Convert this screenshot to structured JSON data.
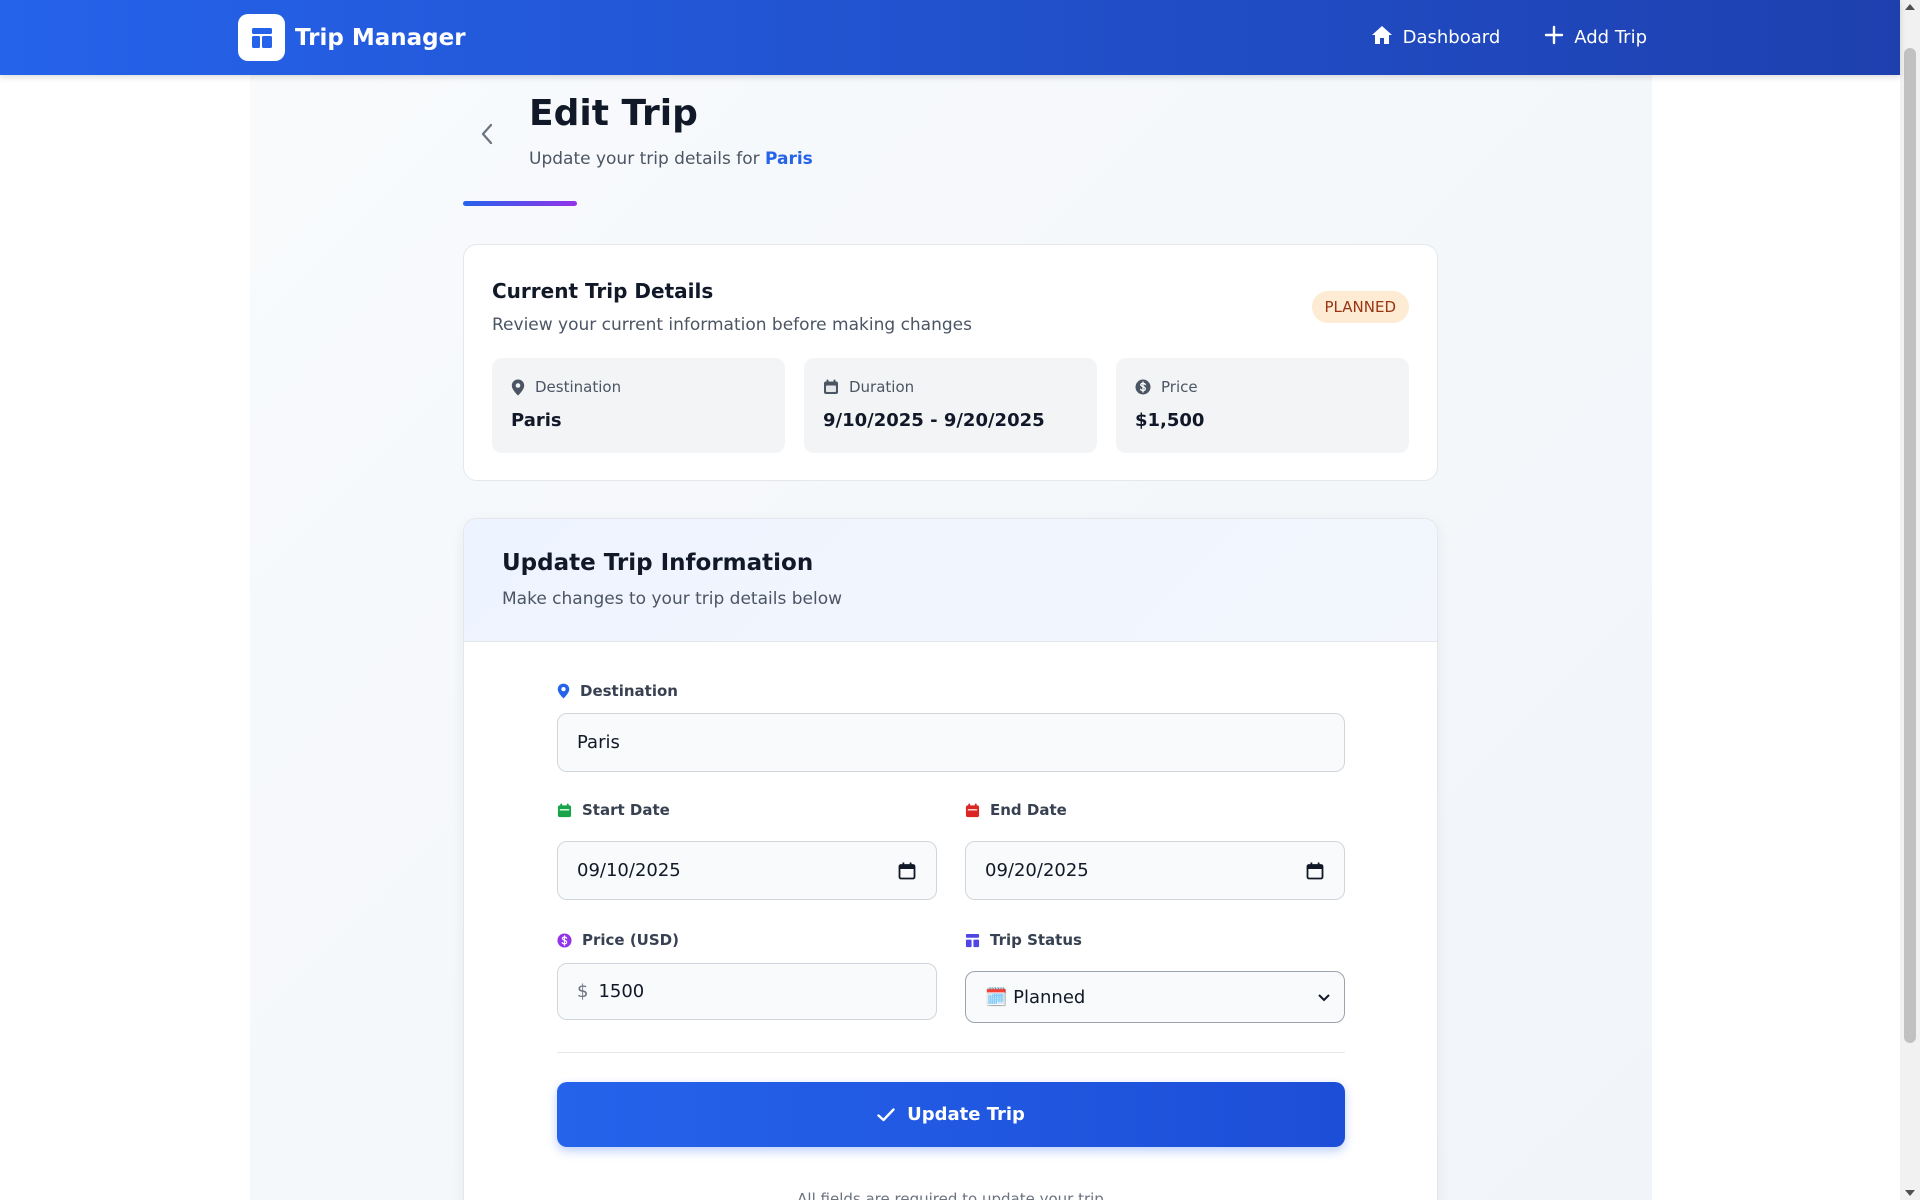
{
  "navbar": {
    "brand": "Trip Manager",
    "links": [
      {
        "label": "Dashboard",
        "icon": "home-icon"
      },
      {
        "label": "Add Trip",
        "icon": "plus-icon"
      }
    ]
  },
  "header": {
    "title": "Edit Trip",
    "subtitle_prefix": "Update your trip details for ",
    "destination": "Paris"
  },
  "current_trip": {
    "title": "Current Trip Details",
    "subtitle": "Review your current information before making changes",
    "status_badge": "PLANNED",
    "items": [
      {
        "label": "Destination",
        "value": "Paris",
        "icon": "map-pin-icon"
      },
      {
        "label": "Duration",
        "value": "9/10/2025 - 9/20/2025",
        "icon": "calendar-icon"
      },
      {
        "label": "Price",
        "value": "$1,500",
        "icon": "dollar-circle-icon"
      }
    ]
  },
  "update_form": {
    "title": "Update Trip Information",
    "subtitle": "Make changes to your trip details below",
    "destination": {
      "label": "Destination",
      "value": "Paris"
    },
    "start_date": {
      "label": "Start Date",
      "value": "09/10/2025"
    },
    "end_date": {
      "label": "End Date",
      "value": "09/20/2025"
    },
    "price": {
      "label": "Price (USD)",
      "currency_symbol": "$",
      "value": "1500"
    },
    "status": {
      "label": "Trip Status",
      "value": "🗓️ Planned"
    },
    "submit_label": "Update Trip",
    "footer_note": "All fields are required to update your trip"
  },
  "colors": {
    "primary": "#2563eb",
    "badge_bg": "#fdebd3",
    "badge_text": "#9a3412",
    "start_icon": "#16a34a",
    "end_icon": "#dc2626",
    "price_icon": "#9333ea",
    "status_icon": "#4f46e5"
  }
}
